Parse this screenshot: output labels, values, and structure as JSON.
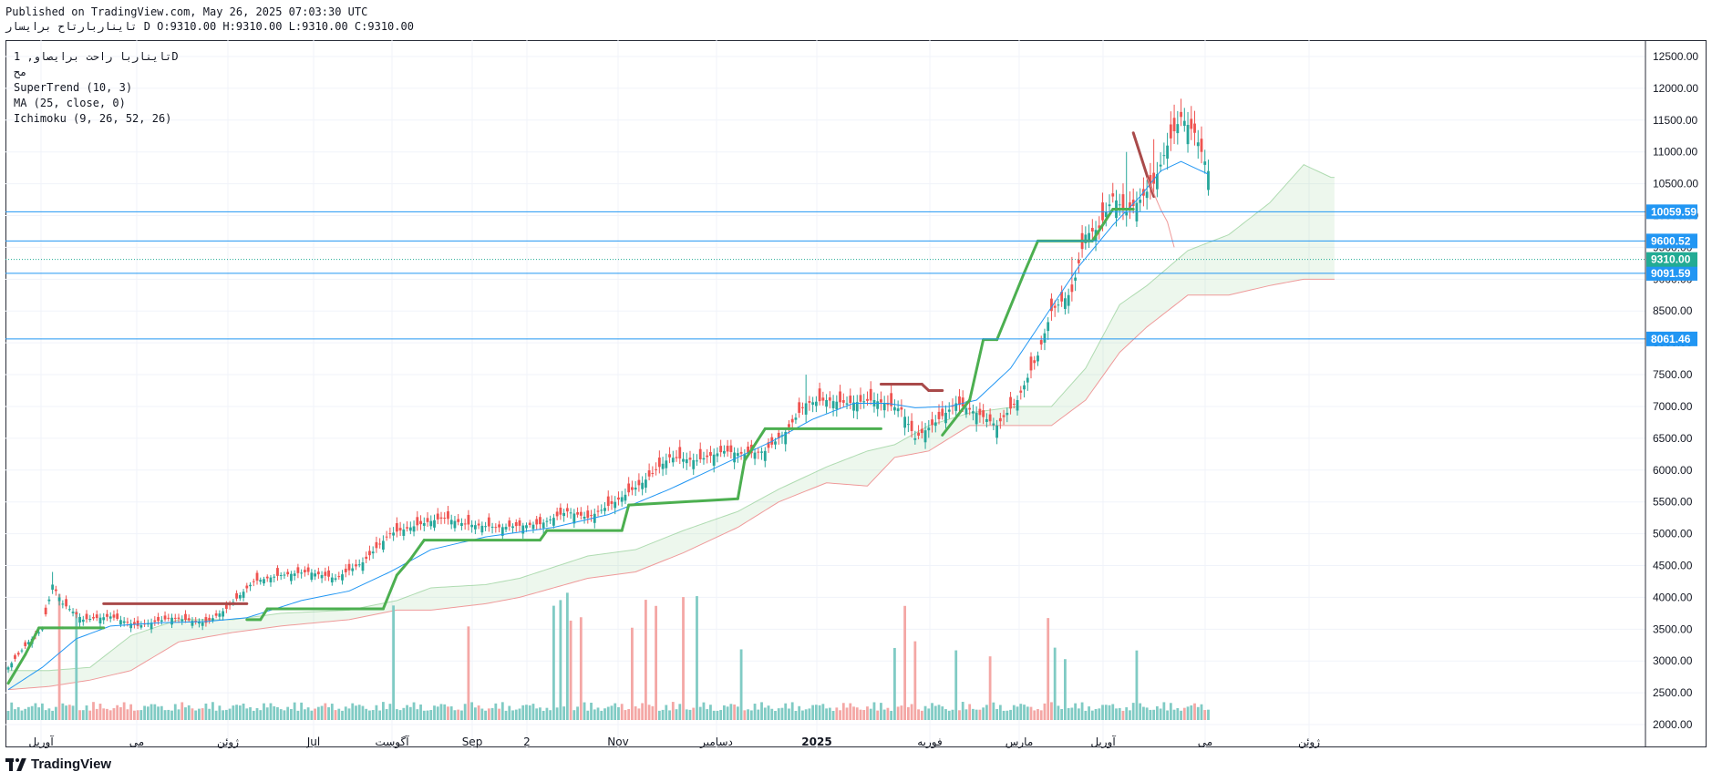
{
  "header": {
    "line1": "Published on TradingView.com, May 26, 2025 07:03:30 UTC",
    "line2_name": "تایناربارتاح برایسار",
    "line2_ohlc": "D O:9310.00 H:9310.00 L:9310.00 C:9310.00"
  },
  "legend": {
    "title": "تایناربا راحت برایصاو, 1D",
    "subtitle": "مح",
    "indicators": [
      "SuperTrend (10, 3)",
      "MA (25, close, 0)",
      "Ichimoku (9, 26, 52, 26)"
    ]
  },
  "footer": {
    "brand": "TradingView"
  },
  "colors": {
    "up": "#26a69a",
    "down": "#ef5350",
    "vol_up": "#80cbc4",
    "vol_down": "#f4a7a5",
    "st_up": "#4caf50",
    "st_down": "#a94a4a",
    "ma": "#2196f3",
    "cloud": "#4caf50",
    "cloud_lower": "#ef9a9a",
    "hline": "#2196f3",
    "last": "#22ab94"
  },
  "chart_data": {
    "type": "candlestick",
    "timeframe": "1D",
    "ylim": [
      1700,
      12700
    ],
    "yticks": [
      2000,
      2500,
      3000,
      3500,
      4000,
      4500,
      5000,
      5500,
      6000,
      6500,
      7000,
      7500,
      8000,
      8500,
      9000,
      9500,
      10000,
      10500,
      11000,
      11500,
      12000,
      12500
    ],
    "xticks": [
      "آوریل",
      "می",
      "ژوئن",
      "Jul",
      "آگوست",
      "Sep",
      "2",
      "Nov",
      "دسامبر",
      "2025",
      "فوریه",
      "مارس",
      "آوریل",
      "می",
      "ژوئن"
    ],
    "xtick_bold": "2025",
    "horizontal_lines": [
      10059.59,
      9600.52,
      9091.59,
      8061.46
    ],
    "last_price": 9310.0,
    "close_keypoints": [
      [
        0,
        2900
      ],
      [
        6,
        3300
      ],
      [
        10,
        3500
      ],
      [
        13,
        4200
      ],
      [
        16,
        3900
      ],
      [
        22,
        3650
      ],
      [
        30,
        3700
      ],
      [
        38,
        3550
      ],
      [
        48,
        3680
      ],
      [
        58,
        3600
      ],
      [
        64,
        3820
      ],
      [
        72,
        4250
      ],
      [
        80,
        4350
      ],
      [
        88,
        4400
      ],
      [
        96,
        4300
      ],
      [
        104,
        4550
      ],
      [
        112,
        5000
      ],
      [
        118,
        5100
      ],
      [
        124,
        5200
      ],
      [
        128,
        5250
      ],
      [
        134,
        5150
      ],
      [
        144,
        5100
      ],
      [
        156,
        5150
      ],
      [
        164,
        5350
      ],
      [
        170,
        5250
      ],
      [
        178,
        5500
      ],
      [
        186,
        5800
      ],
      [
        194,
        6200
      ],
      [
        202,
        6150
      ],
      [
        210,
        6300
      ],
      [
        216,
        6250
      ],
      [
        222,
        6300
      ],
      [
        228,
        6600
      ],
      [
        234,
        7050
      ],
      [
        240,
        7100
      ],
      [
        246,
        7050
      ],
      [
        254,
        7100
      ],
      [
        262,
        6950
      ],
      [
        266,
        6500
      ],
      [
        272,
        6750
      ],
      [
        278,
        7050
      ],
      [
        284,
        6900
      ],
      [
        290,
        6700
      ],
      [
        296,
        7100
      ],
      [
        302,
        7800
      ],
      [
        306,
        8500
      ],
      [
        312,
        8800
      ],
      [
        316,
        9700
      ],
      [
        320,
        9800
      ],
      [
        324,
        10300
      ],
      [
        328,
        10050
      ],
      [
        332,
        10250
      ],
      [
        336,
        10500
      ],
      [
        340,
        11100
      ],
      [
        344,
        11550
      ],
      [
        348,
        11300
      ],
      [
        352,
        10700
      ]
    ],
    "spikes": [
      [
        13,
        4400
      ],
      [
        234,
        7500
      ],
      [
        312,
        9350
      ],
      [
        328,
        11000
      ],
      [
        336,
        11200
      ],
      [
        344,
        11600
      ]
    ],
    "volume_spikes": [
      [
        15,
        2000
      ],
      [
        20,
        1700
      ],
      [
        113,
        1800
      ],
      [
        135,
        1450
      ],
      [
        160,
        1700
      ],
      [
        162,
        1800
      ],
      [
        164,
        2000
      ],
      [
        165,
        1550
      ],
      [
        168,
        1600
      ],
      [
        183,
        1450
      ],
      [
        187,
        1850
      ],
      [
        190,
        1800
      ],
      [
        198,
        1950
      ],
      [
        202,
        1900
      ],
      [
        215,
        1000
      ],
      [
        260,
        1050
      ],
      [
        263,
        1700
      ],
      [
        266,
        1200
      ],
      [
        278,
        950
      ],
      [
        288,
        880
      ],
      [
        305,
        1600
      ],
      [
        307,
        1050
      ],
      [
        310,
        900
      ],
      [
        331,
        1000
      ]
    ],
    "volume_ylim": [
      0,
      7000
    ],
    "volume_colors_down_ranges": [
      [
        24,
        38
      ],
      [
        180,
        190
      ],
      [
        244,
        252
      ],
      [
        262,
        268
      ],
      [
        300,
        306
      ]
    ],
    "supertrend": [
      [
        0,
        2650,
        "up"
      ],
      [
        5,
        3100,
        "up"
      ],
      [
        9,
        3520,
        "up"
      ],
      [
        16,
        3520,
        "up"
      ],
      [
        28,
        3520,
        "up"
      ],
      [
        28,
        3900,
        "down"
      ],
      [
        70,
        3900,
        "down"
      ],
      [
        70,
        3650,
        "up"
      ],
      [
        74,
        3650,
        "up"
      ],
      [
        76,
        3820,
        "up"
      ],
      [
        110,
        3820,
        "up"
      ],
      [
        114,
        4350,
        "up"
      ],
      [
        118,
        4600,
        "up"
      ],
      [
        122,
        4900,
        "up"
      ],
      [
        156,
        4900,
        "up"
      ],
      [
        158,
        5050,
        "up"
      ],
      [
        180,
        5050,
        "up"
      ],
      [
        182,
        5450,
        "up"
      ],
      [
        214,
        5550,
        "up"
      ],
      [
        216,
        6150,
        "up"
      ],
      [
        222,
        6650,
        "up"
      ],
      [
        256,
        6650,
        "up"
      ],
      [
        256,
        7350,
        "down"
      ],
      [
        268,
        7350,
        "down"
      ],
      [
        270,
        7250,
        "down"
      ],
      [
        274,
        7250,
        "down"
      ],
      [
        274,
        6550,
        "up"
      ],
      [
        282,
        7100,
        "up"
      ],
      [
        286,
        8050,
        "up"
      ],
      [
        290,
        8050,
        "up"
      ],
      [
        298,
        9100,
        "up"
      ],
      [
        302,
        9600,
        "up"
      ],
      [
        318,
        9600,
        "up"
      ],
      [
        324,
        10100,
        "up"
      ],
      [
        330,
        10100,
        "up"
      ],
      [
        330,
        11300,
        "down"
      ],
      [
        336,
        10300,
        "down"
      ]
    ],
    "ma_keypoints": [
      [
        0,
        2550
      ],
      [
        10,
        2900
      ],
      [
        20,
        3350
      ],
      [
        30,
        3550
      ],
      [
        44,
        3600
      ],
      [
        58,
        3620
      ],
      [
        70,
        3680
      ],
      [
        86,
        3950
      ],
      [
        100,
        4100
      ],
      [
        112,
        4400
      ],
      [
        124,
        4750
      ],
      [
        140,
        4950
      ],
      [
        160,
        5100
      ],
      [
        176,
        5300
      ],
      [
        194,
        5700
      ],
      [
        210,
        6100
      ],
      [
        224,
        6450
      ],
      [
        236,
        6800
      ],
      [
        248,
        7050
      ],
      [
        258,
        7050
      ],
      [
        266,
        6980
      ],
      [
        276,
        7000
      ],
      [
        284,
        7100
      ],
      [
        294,
        7600
      ],
      [
        304,
        8400
      ],
      [
        314,
        9200
      ],
      [
        324,
        9850
      ],
      [
        332,
        10300
      ],
      [
        338,
        10700
      ],
      [
        344,
        10850
      ],
      [
        352,
        10650
      ]
    ],
    "cloud_upper": [
      [
        0,
        2850
      ],
      [
        12,
        2850
      ],
      [
        24,
        2900
      ],
      [
        36,
        3400
      ],
      [
        50,
        3650
      ],
      [
        66,
        3650
      ],
      [
        80,
        3750
      ],
      [
        100,
        3800
      ],
      [
        114,
        3950
      ],
      [
        124,
        4150
      ],
      [
        140,
        4200
      ],
      [
        150,
        4300
      ],
      [
        170,
        4650
      ],
      [
        184,
        4750
      ],
      [
        198,
        5050
      ],
      [
        214,
        5350
      ],
      [
        226,
        5700
      ],
      [
        240,
        6050
      ],
      [
        252,
        6300
      ],
      [
        260,
        6400
      ],
      [
        270,
        6700
      ],
      [
        282,
        6900
      ],
      [
        296,
        7000
      ],
      [
        306,
        7000
      ],
      [
        316,
        7600
      ],
      [
        326,
        8600
      ],
      [
        334,
        8900
      ],
      [
        346,
        9450
      ],
      [
        358,
        9700
      ],
      [
        370,
        10200
      ],
      [
        380,
        10800
      ],
      [
        388,
        10600
      ]
    ],
    "cloud_lower": [
      [
        0,
        2550
      ],
      [
        12,
        2600
      ],
      [
        24,
        2700
      ],
      [
        36,
        2850
      ],
      [
        50,
        3300
      ],
      [
        66,
        3450
      ],
      [
        80,
        3550
      ],
      [
        100,
        3650
      ],
      [
        114,
        3800
      ],
      [
        124,
        3800
      ],
      [
        140,
        3900
      ],
      [
        150,
        4000
      ],
      [
        170,
        4300
      ],
      [
        184,
        4400
      ],
      [
        198,
        4700
      ],
      [
        214,
        5100
      ],
      [
        226,
        5500
      ],
      [
        240,
        5800
      ],
      [
        252,
        5750
      ],
      [
        260,
        6200
      ],
      [
        270,
        6300
      ],
      [
        282,
        6700
      ],
      [
        296,
        6700
      ],
      [
        306,
        6700
      ],
      [
        316,
        7100
      ],
      [
        326,
        7850
      ],
      [
        334,
        8250
      ],
      [
        346,
        8750
      ],
      [
        358,
        8750
      ],
      [
        370,
        8900
      ],
      [
        380,
        9000
      ],
      [
        388,
        9000
      ]
    ],
    "lagging_span": [
      [
        334,
        10600
      ],
      [
        338,
        10100
      ],
      [
        340,
        9900
      ],
      [
        342,
        9500
      ]
    ]
  }
}
